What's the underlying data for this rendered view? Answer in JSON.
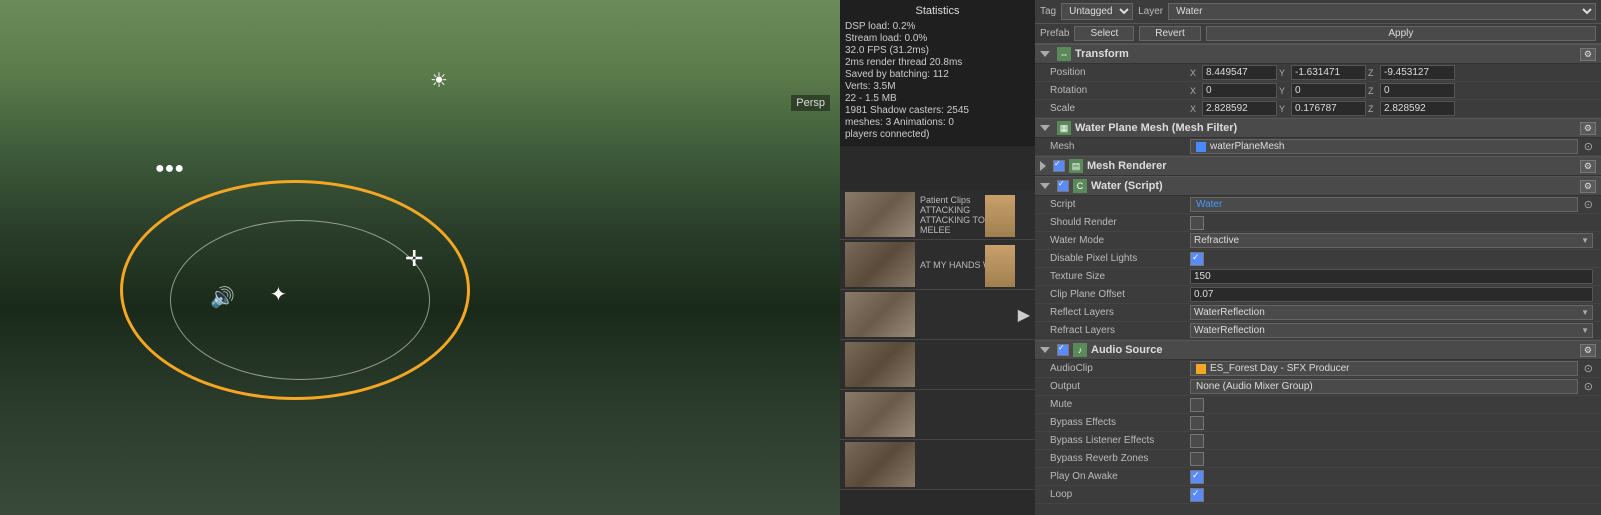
{
  "viewport": {
    "label": "Scene Viewport",
    "perspective_label": "Persp"
  },
  "stats": {
    "title": "Statistics",
    "dsp_load": "DSP load: 0.2%",
    "stream_load": "Stream load: 0.0%",
    "fps": "32.0 FPS (31.2ms)",
    "render_time": "2ms  render thread 20.8ms",
    "batching": "Saved by batching: 112",
    "verts": "Verts: 3.5M",
    "memory": "22 - 1.5 MB",
    "shadow_casters": "1981  Shadow casters: 2545",
    "meshes": "meshes: 3  Animations: 0",
    "players": "players connected)"
  },
  "inspector": {
    "tag_label": "Tag",
    "tag_value": "Untagged",
    "layer_label": "Layer",
    "layer_value": "Water",
    "prefab_label": "Prefab",
    "select_btn": "Select",
    "revert_btn": "Revert",
    "apply_btn": "Apply",
    "transform": {
      "title": "Transform",
      "position_label": "Position",
      "pos_x": "8.449547",
      "pos_y": "-1.631471",
      "pos_z": "-9.453127",
      "rotation_label": "Rotation",
      "rot_x": "0",
      "rot_y": "0",
      "rot_z": "0",
      "scale_label": "Scale",
      "scale_x": "2.828592",
      "scale_y": "0.176787",
      "scale_z": "2.828592"
    },
    "mesh_filter": {
      "title": "Water Plane Mesh (Mesh Filter)",
      "mesh_label": "Mesh",
      "mesh_value": "waterPlaneMesh"
    },
    "mesh_renderer": {
      "title": "Mesh Renderer"
    },
    "water_script": {
      "title": "Water (Script)",
      "script_label": "Script",
      "script_value": "Water",
      "should_render_label": "Should Render",
      "water_mode_label": "Water Mode",
      "water_mode_value": "Refractive",
      "disable_pixel_lights_label": "Disable Pixel Lights",
      "texture_size_label": "Texture Size",
      "texture_size_value": "150",
      "clip_plane_offset_label": "Clip Plane Offset",
      "clip_plane_offset_value": "0.07",
      "reflect_layers_label": "Reflect Layers",
      "reflect_layers_value": "WaterReflection",
      "refract_layers_label": "Refract Layers",
      "refract_layers_value": "WaterReflection"
    },
    "audio_source": {
      "title": "Audio Source",
      "audio_clip_label": "AudioClip",
      "audio_clip_value": "ES_Forest Day - SFX Producer",
      "output_label": "Output",
      "output_value": "None (Audio Mixer Group)",
      "mute_label": "Mute",
      "bypass_effects_label": "Bypass Effects",
      "bypass_listener_label": "Bypass Listener Effects",
      "bypass_reverb_label": "Bypass Reverb Zones",
      "play_on_awake_label": "Play On Awake",
      "loop_label": "Loop"
    }
  }
}
